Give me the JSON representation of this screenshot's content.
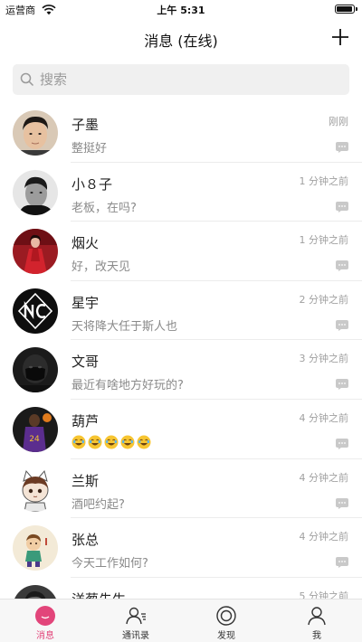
{
  "status_bar": {
    "carrier": "运营商",
    "time": "上午 5:31",
    "battery_level": 0.95
  },
  "nav": {
    "title": "消息 (在线)",
    "add_icon": "plus-icon"
  },
  "search": {
    "placeholder": "搜索",
    "value": ""
  },
  "colors": {
    "accent": "#e2457a",
    "divider": "#ececec",
    "search_bg": "#f0f0f0",
    "tab_bar_bg": "#f7f7f7"
  },
  "chats": [
    {
      "name": "子墨",
      "message": "整挺好",
      "time": "刚刚",
      "avatar": "young-man-portrait"
    },
    {
      "name": "小８子",
      "message": "老板，在吗?",
      "time": "1 分钟之前",
      "avatar": "man-black-and-white-portrait"
    },
    {
      "name": "烟火",
      "message": "好，改天见",
      "time": "1 分钟之前",
      "avatar": "woman-red-dress"
    },
    {
      "name": "星宇",
      "message": "天将降大任于斯人也",
      "time": "2 分钟之前",
      "avatar": "nc-logo"
    },
    {
      "name": "文哥",
      "message": "最近有啥地方好玩的?",
      "time": "3 分钟之前",
      "avatar": "masked-figure"
    },
    {
      "name": "葫芦",
      "message": "",
      "emoji": [
        "😂",
        "😂",
        "😂",
        "😂",
        "😂"
      ],
      "time": "4 分钟之前",
      "avatar": "basketball-player"
    },
    {
      "name": "兰斯",
      "message": "酒吧约起?",
      "time": "4 分钟之前",
      "avatar": "anime-cat-ears-character"
    },
    {
      "name": "张总",
      "message": "今天工作如何?",
      "time": "4 分钟之前",
      "avatar": "cartoon-figure"
    },
    {
      "name": "洋葱先生",
      "message": "",
      "time": "5 分钟之前",
      "avatar": "dark-portrait"
    }
  ],
  "tabs": [
    {
      "label": "消息",
      "icon": "chat-bubble-icon",
      "active": true
    },
    {
      "label": "通讯录",
      "icon": "contacts-icon",
      "active": false
    },
    {
      "label": "发现",
      "icon": "discover-icon",
      "active": false
    },
    {
      "label": "我",
      "icon": "profile-icon",
      "active": false
    }
  ]
}
